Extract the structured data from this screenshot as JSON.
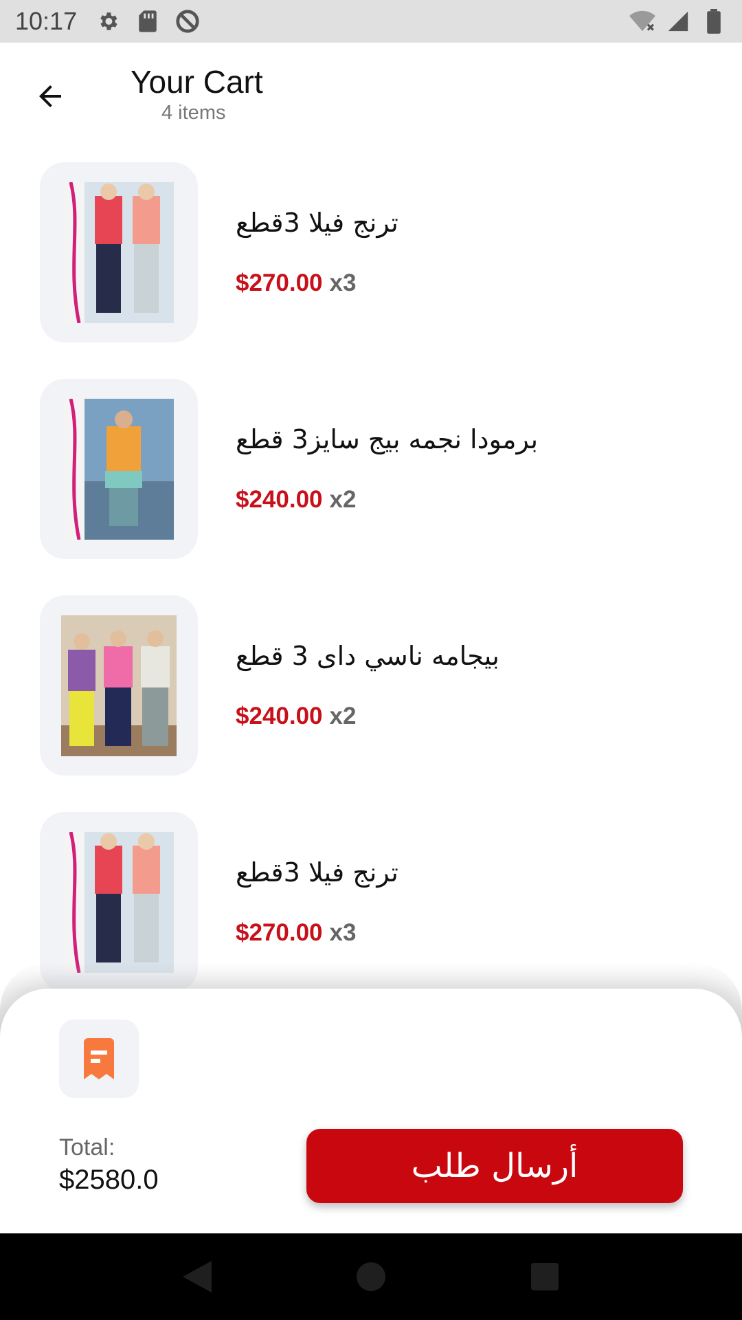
{
  "status_bar": {
    "time": "10:17",
    "icons": [
      "gear-icon",
      "sd-card-icon",
      "data-saver-icon",
      "wifi-off-icon",
      "signal-icon",
      "battery-icon"
    ]
  },
  "header": {
    "title": "Your Cart",
    "subtitle": "4 items",
    "back_icon": "arrow-left-icon"
  },
  "cart": {
    "items": [
      {
        "name": "ترنج فيلا 3قطع",
        "price": "$270.00",
        "qty": "x3"
      },
      {
        "name": "برمودا نجمه بيج سايز3 قطع",
        "price": "$240.00",
        "qty": "x2"
      },
      {
        "name": "بيجامه ناسي داى  3 قطع",
        "price": "$240.00",
        "qty": "x2"
      },
      {
        "name": "ترنج فيلا 3قطع",
        "price": "$270.00",
        "qty": "x3"
      }
    ]
  },
  "checkout": {
    "receipt_icon": "receipt-icon",
    "total_label": "Total:",
    "total_value": "$2580.0",
    "button_label": "أرسال طلب"
  },
  "colors": {
    "accent": "#c8070f",
    "price": "#c8101a",
    "receipt_icon": "#f7793d",
    "thumb_bg": "#f2f3f7"
  },
  "nav": {
    "icons": [
      "back-triangle-icon",
      "home-circle-icon",
      "recents-square-icon"
    ]
  }
}
